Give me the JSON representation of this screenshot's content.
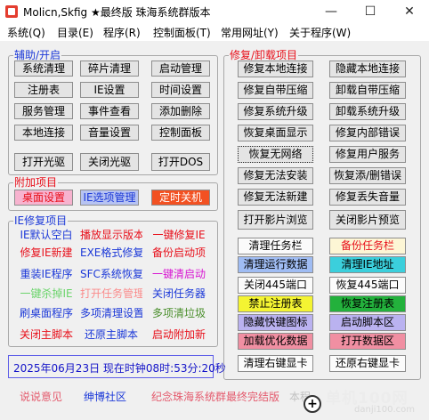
{
  "window": {
    "title": "Molicn,Skfig ★最终版 珠海系统群版本",
    "minimize_glyph": "—",
    "maximize_glyph": "☐",
    "close_glyph": "✕"
  },
  "menu": [
    "系统(Q)",
    "目录(E)",
    "程序(R)",
    "控制面板(T)",
    "常用网址(Y)",
    "关于程序(W)"
  ],
  "groups": {
    "assist": "辅助/开启",
    "attach": "附加项目",
    "ie": "IE修复项目",
    "repair": "修复/卸载项目"
  },
  "assist_buttons": [
    "系统清理",
    "碎片清理",
    "启动管理",
    "注册表",
    "IE设置",
    "时间设置",
    "服务管理",
    "事件查看",
    "添加删除",
    "本地连接",
    "音量设置",
    "控制面板",
    "打开光驱",
    "关闭光驱",
    "打开DOS"
  ],
  "attach_buttons": [
    "桌面设置",
    "IE选项管理",
    "定时关机"
  ],
  "ie_buttons": [
    "IE默认空白",
    "播放显示版本",
    "一键修复IE",
    "修复IE新建",
    "EXE格式修复",
    "备份启动项",
    "重装IE程序",
    "SFC系统恢复",
    "一键清启动",
    "一键杀掉IE",
    "打开任务管理",
    "关闭任务器",
    "刷桌面程序",
    "多项清理设置",
    "多项清垃圾",
    "关闭主脚本",
    "还原主脚本",
    "启动附加新"
  ],
  "repair_buttons": [
    "修复本地连接",
    "隐藏本地连接",
    "修复自带压缩",
    "卸载自带压缩",
    "修复系统升级",
    "卸载系统升级",
    "恢复桌面显示",
    "修复内部错误",
    "恢复无网络",
    "修复用户服务",
    "修复无法安装",
    "恢复添/删错误",
    "修复无法新建",
    "修复丢失音量",
    "打开影片浏览",
    "关闭影片预览"
  ],
  "tool_buttons": [
    "清理任务栏",
    "备份任务栏",
    "清理运行数据",
    "清理IE地址",
    "关闭445端口",
    "恢复445端口",
    "禁止注册表",
    "恢复注册表",
    "隐藏快键图标",
    "启动脚本区",
    "加载优化数据",
    "打开数据区",
    "清理右键显卡",
    "还原右键显卡"
  ],
  "status": "2025年06月23日 现在时钟08时:53分:20秒",
  "footer": [
    "说说意见",
    "绅博社区",
    "纪念珠海系统群最终完结版",
    "本程"
  ],
  "watermark": {
    "line1": "单机100网",
    "line2": "danji100.com"
  },
  "colors": {
    "accent_red": "#e8101b",
    "accent_blue": "#1b38d8",
    "footer_pink": "#e45a6d"
  }
}
